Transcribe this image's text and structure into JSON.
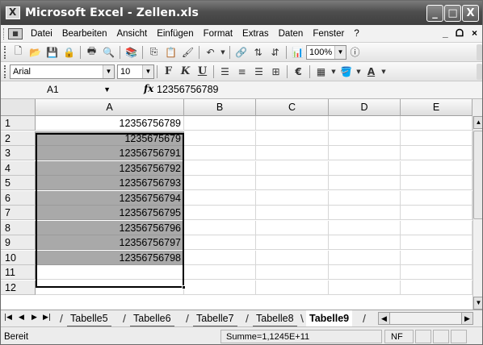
{
  "window": {
    "title": "Microsoft Excel - Zellen.xls",
    "minimize": "_",
    "maximize": "□",
    "close": "X"
  },
  "menubar": {
    "items": [
      "Datei",
      "Bearbeiten",
      "Ansicht",
      "Einfügen",
      "Format",
      "Extras",
      "Daten",
      "Fenster",
      "?"
    ],
    "doc_minimize": "_",
    "doc_restore": "ᗝ",
    "doc_close": "×"
  },
  "toolbar": {
    "zoom": "100%",
    "font_name": "Arial",
    "font_size": "10",
    "bold": "F",
    "italic": "K",
    "underline": "U",
    "euro": "€",
    "font_color_letter": "A"
  },
  "formula_bar": {
    "name_box": "A1",
    "fx": "fx",
    "content": "12356756789"
  },
  "columns": [
    "A",
    "B",
    "C",
    "D",
    "E"
  ],
  "rows": [
    {
      "num": "1",
      "a": "12356756789"
    },
    {
      "num": "2",
      "a": "1235675679"
    },
    {
      "num": "3",
      "a": "12356756791"
    },
    {
      "num": "4",
      "a": "12356756792"
    },
    {
      "num": "5",
      "a": "12356756793"
    },
    {
      "num": "6",
      "a": "12356756794"
    },
    {
      "num": "7",
      "a": "12356756795"
    },
    {
      "num": "8",
      "a": "12356756796"
    },
    {
      "num": "9",
      "a": "12356756797"
    },
    {
      "num": "10",
      "a": "12356756798"
    },
    {
      "num": "11",
      "a": ""
    },
    {
      "num": "12",
      "a": ""
    }
  ],
  "sheet_tabs": [
    "Tabelle5",
    "Tabelle6",
    "Tabelle7",
    "Tabelle8",
    "Tabelle9"
  ],
  "active_sheet": "Tabelle9",
  "status": {
    "left": "Bereit",
    "sum": "Summe=1,1245E+11",
    "nf": "NF"
  }
}
